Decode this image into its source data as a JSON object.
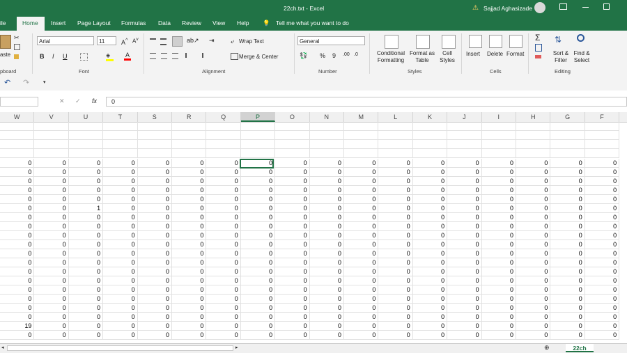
{
  "window": {
    "title": "22ch.txt  -  Excel",
    "user": "Sajjad Aghasizade",
    "brand_color": "#217346"
  },
  "tabs": [
    "ile",
    "Home",
    "Insert",
    "Page Layout",
    "Formulas",
    "Data",
    "Review",
    "View",
    "Help"
  ],
  "tell_me": "Tell me what you want to do",
  "ribbon": {
    "clipboard": {
      "paste": "aste",
      "label": "pboard"
    },
    "font": {
      "name": "Arial",
      "size": "11",
      "bold": "B",
      "italic": "I",
      "underline": "U",
      "label": "Font"
    },
    "alignment": {
      "wrap": "Wrap Text",
      "merge": "Merge & Center",
      "label": "Alignment"
    },
    "number": {
      "format": "General",
      "percent": "%",
      "comma": "9",
      "label": "Number"
    },
    "styles": {
      "conditional_1": "Conditional",
      "conditional_2": "Formatting",
      "table_1": "Format as",
      "table_2": "Table",
      "cell_1": "Cell",
      "cell_2": "Styles",
      "label": "Styles"
    },
    "cells": {
      "insert": "Insert",
      "delete": "Delete",
      "format": "Format",
      "label": "Cells"
    },
    "editing": {
      "sort_1": "Sort &",
      "sort_2": "Filter",
      "find_1": "Find &",
      "find_2": "Select",
      "label": "Editing"
    }
  },
  "formula_bar": {
    "value": "0",
    "fx": "fx"
  },
  "columns": [
    "W",
    "V",
    "U",
    "T",
    "S",
    "R",
    "Q",
    "P",
    "O",
    "N",
    "M",
    "L",
    "K",
    "J",
    "I",
    "H",
    "G",
    "F"
  ],
  "rows": [
    [
      "0",
      "0",
      "0",
      "0",
      "0",
      "0",
      "0",
      "0",
      "0",
      "0",
      "0",
      "0",
      "0",
      "0",
      "0",
      "0",
      "0",
      "0"
    ],
    [
      "0",
      "0",
      "0",
      "0",
      "0",
      "0",
      "0",
      "0",
      "0",
      "0",
      "0",
      "0",
      "0",
      "0",
      "0",
      "0",
      "0",
      "0"
    ],
    [
      "0",
      "0",
      "0",
      "0",
      "0",
      "0",
      "0",
      "0",
      "0",
      "0",
      "0",
      "0",
      "0",
      "0",
      "0",
      "0",
      "0",
      "0"
    ],
    [
      "0",
      "0",
      "0",
      "0",
      "0",
      "0",
      "0",
      "0",
      "0",
      "0",
      "0",
      "0",
      "0",
      "0",
      "0",
      "0",
      "0",
      "0"
    ],
    [
      "0",
      "0",
      "0",
      "0",
      "0",
      "0",
      "0",
      "0",
      "0",
      "0",
      "0",
      "0",
      "0",
      "0",
      "0",
      "0",
      "0",
      "0"
    ],
    [
      "0",
      "0",
      "1",
      "0",
      "0",
      "0",
      "0",
      "0",
      "0",
      "0",
      "0",
      "0",
      "0",
      "0",
      "0",
      "0",
      "0",
      "0"
    ],
    [
      "0",
      "0",
      "0",
      "0",
      "0",
      "0",
      "0",
      "0",
      "0",
      "0",
      "0",
      "0",
      "0",
      "0",
      "0",
      "0",
      "0",
      "0"
    ],
    [
      "0",
      "0",
      "0",
      "0",
      "0",
      "0",
      "0",
      "0",
      "0",
      "0",
      "0",
      "0",
      "0",
      "0",
      "0",
      "0",
      "0",
      "0"
    ],
    [
      "0",
      "0",
      "0",
      "0",
      "0",
      "0",
      "0",
      "0",
      "0",
      "0",
      "0",
      "0",
      "0",
      "0",
      "0",
      "0",
      "0",
      "0"
    ],
    [
      "0",
      "0",
      "0",
      "0",
      "0",
      "0",
      "0",
      "0",
      "0",
      "0",
      "0",
      "0",
      "0",
      "0",
      "0",
      "0",
      "0",
      "0"
    ],
    [
      "0",
      "0",
      "0",
      "0",
      "0",
      "0",
      "0",
      "0",
      "0",
      "0",
      "0",
      "0",
      "0",
      "0",
      "0",
      "0",
      "0",
      "0"
    ],
    [
      "0",
      "0",
      "0",
      "0",
      "0",
      "0",
      "0",
      "0",
      "0",
      "0",
      "0",
      "0",
      "0",
      "0",
      "0",
      "0",
      "0",
      "0"
    ],
    [
      "0",
      "0",
      "0",
      "0",
      "0",
      "0",
      "0",
      "0",
      "0",
      "0",
      "0",
      "0",
      "0",
      "0",
      "0",
      "0",
      "0",
      "0"
    ],
    [
      "0",
      "0",
      "0",
      "0",
      "0",
      "0",
      "0",
      "0",
      "0",
      "0",
      "0",
      "0",
      "0",
      "0",
      "0",
      "0",
      "0",
      "0"
    ],
    [
      "0",
      "0",
      "0",
      "0",
      "0",
      "0",
      "0",
      "0",
      "0",
      "0",
      "0",
      "0",
      "0",
      "0",
      "0",
      "0",
      "0",
      "0"
    ],
    [
      "0",
      "0",
      "0",
      "0",
      "0",
      "0",
      "0",
      "0",
      "0",
      "0",
      "0",
      "0",
      "0",
      "0",
      "0",
      "0",
      "0",
      "0"
    ],
    [
      "0",
      "0",
      "0",
      "0",
      "0",
      "0",
      "0",
      "0",
      "0",
      "0",
      "0",
      "0",
      "0",
      "0",
      "0",
      "0",
      "0",
      "0"
    ],
    [
      "0",
      "0",
      "0",
      "0",
      "0",
      "0",
      "0",
      "0",
      "0",
      "0",
      "0",
      "0",
      "0",
      "0",
      "0",
      "0",
      "0",
      "0"
    ],
    [
      "19",
      "0",
      "0",
      "0",
      "0",
      "0",
      "0",
      "0",
      "0",
      "0",
      "0",
      "0",
      "0",
      "0",
      "0",
      "0",
      "0",
      "0"
    ],
    [
      "0",
      "0",
      "0",
      "0",
      "0",
      "0",
      "0",
      "0",
      "0",
      "0",
      "0",
      "0",
      "0",
      "0",
      "0",
      "0",
      "0",
      "0"
    ]
  ],
  "selected_cell": {
    "column": "P",
    "row_index": 0
  },
  "sheet_tab": "22ch"
}
